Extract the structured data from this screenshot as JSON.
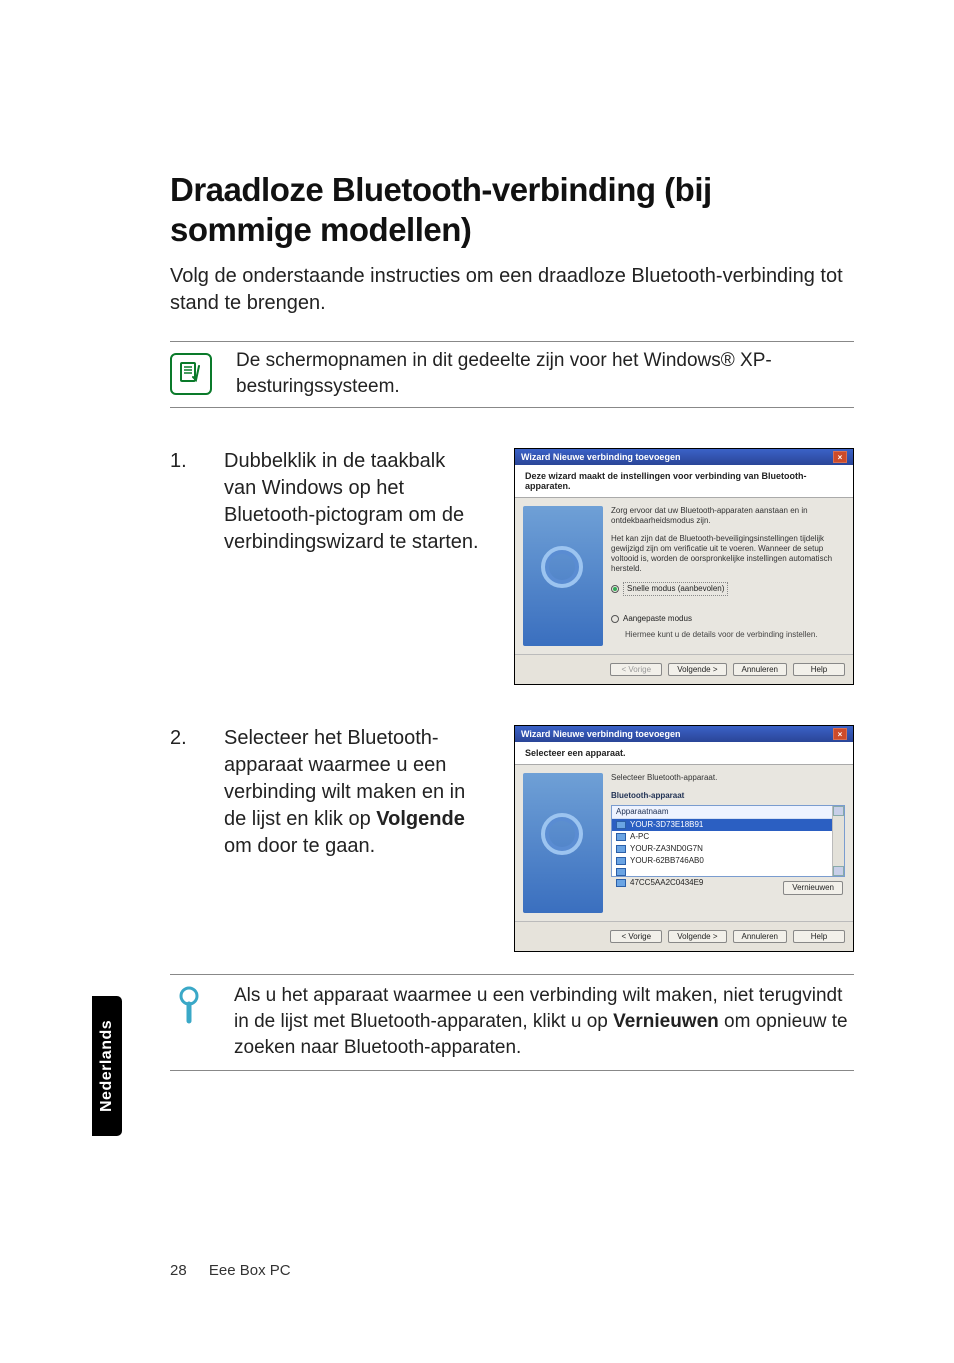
{
  "heading": "Draadloze Bluetooth-verbinding (bij sommige modellen)",
  "intro": "Volg de onderstaande instructies om een draadloze Bluetooth-verbinding tot stand te brengen.",
  "note": "De schermopnamen in dit gedeelte zijn voor het Windows® XP-besturingssysteem.",
  "steps": [
    {
      "num": "1.",
      "lead": "Dubbelklik in de taakbalk",
      "rest": " van Windows op het Bluetooth-pictogram om de verbindingswizard te starten."
    },
    {
      "num": "2.",
      "lead": "Selecteer het Bluetooth-",
      "rest_pre": "apparaat waarmee u een verbinding wilt maken en in de lijst en klik op ",
      "bold": "Volgende",
      "rest_post": " om door te gaan."
    }
  ],
  "wizard1": {
    "title": "Wizard Nieuwe verbinding toevoegen",
    "header": "Deze wizard maakt de instellingen voor verbinding van Bluetooth-apparaten.",
    "body1": "Zorg ervoor dat uw Bluetooth-apparaten aanstaan en in ontdekbaarheidsmodus zijn.",
    "body2": "Het kan zijn dat de Bluetooth-beveiligingsinstellingen tijdelijk gewijzigd zijn om verificatie uit te voeren. Wanneer de setup voltooid is, worden de oorspronkelijke instellingen automatisch hersteld.",
    "option1": "Snelle modus (aanbevolen)",
    "option2": "Aangepaste modus",
    "option2_sub": "Hiermee kunt u de details voor de verbinding instellen.",
    "buttons": {
      "back": "< Vorige",
      "next": "Volgende >",
      "cancel": "Annuleren",
      "help": "Help"
    }
  },
  "wizard2": {
    "title": "Wizard Nieuwe verbinding toevoegen",
    "header": "Selecteer een apparaat.",
    "prompt": "Selecteer Bluetooth-apparaat.",
    "group": "Bluetooth-apparaat",
    "col": "Apparaatnaam",
    "devices": [
      "YOUR-3D73E18B91",
      "A-PC",
      "YOUR-ZA3ND0G7N",
      "YOUR-62BB746AB0",
      "",
      "47CC5AA2C0434E9"
    ],
    "refresh": "Vernieuwen",
    "buttons": {
      "back": "< Vorige",
      "next": "Volgende >",
      "cancel": "Annuleren",
      "help": "Help"
    }
  },
  "tip_pre": "Als u het apparaat waarmee u een verbinding wilt maken, niet terugvindt in de lijst met Bluetooth-apparaten, klikt u op ",
  "tip_bold": "Vernieuwen",
  "tip_post": " om opnieuw te zoeken naar Bluetooth-apparaten.",
  "language_tab": "Nederlands",
  "footer": {
    "page": "28",
    "product": "Eee Box PC"
  }
}
